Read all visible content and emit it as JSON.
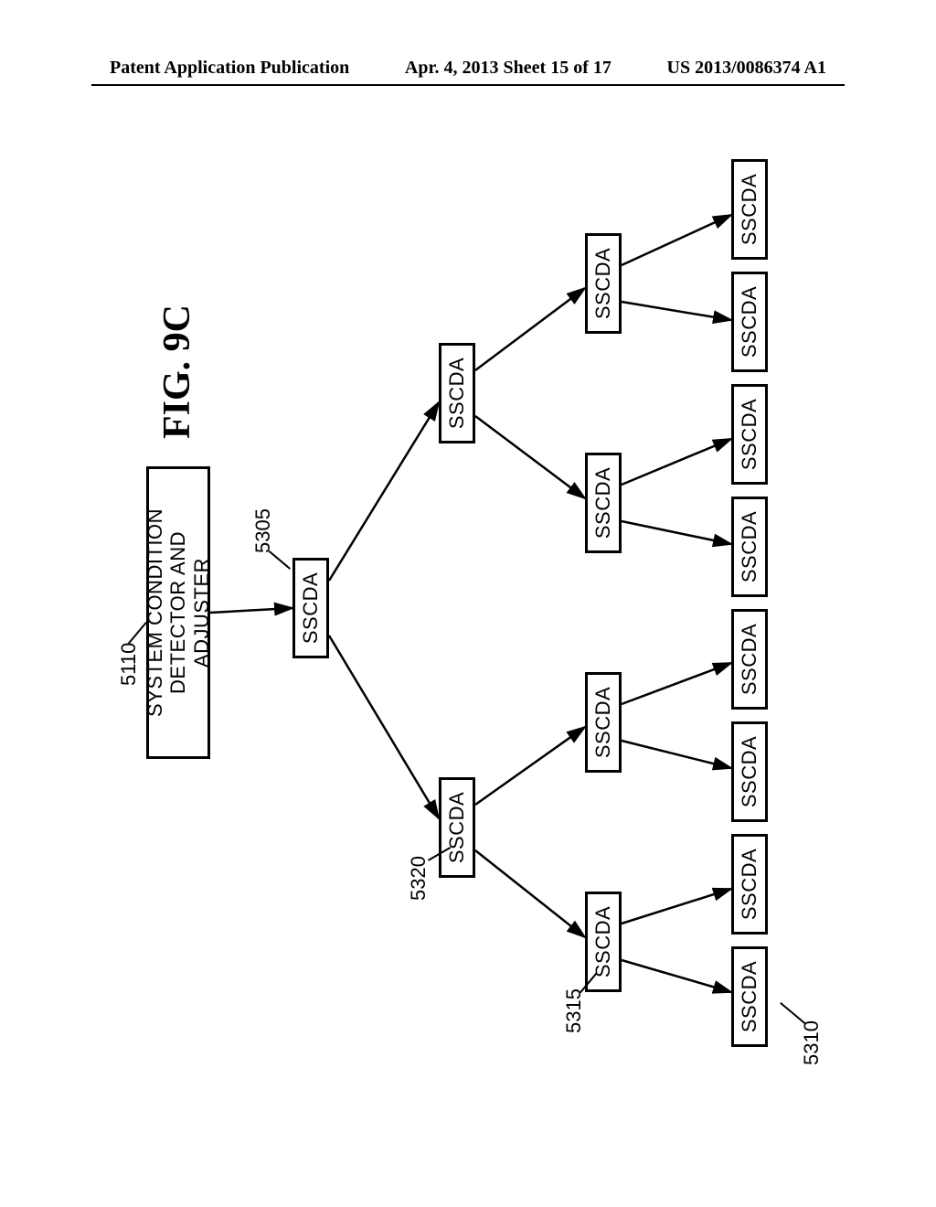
{
  "header": {
    "left": "Patent Application Publication",
    "center": "Apr. 4, 2013  Sheet 15 of 17",
    "right": "US 2013/0086374 A1"
  },
  "figure": {
    "title": "FIG. 9C",
    "root_label": "SYSTEM CONDITION\nDETECTOR AND ADJUSTER",
    "sub_label": "SSCDA",
    "refs": {
      "r5110": "5110",
      "r5305": "5305",
      "r5320": "5320",
      "r5315": "5315",
      "r5310": "5310"
    }
  }
}
